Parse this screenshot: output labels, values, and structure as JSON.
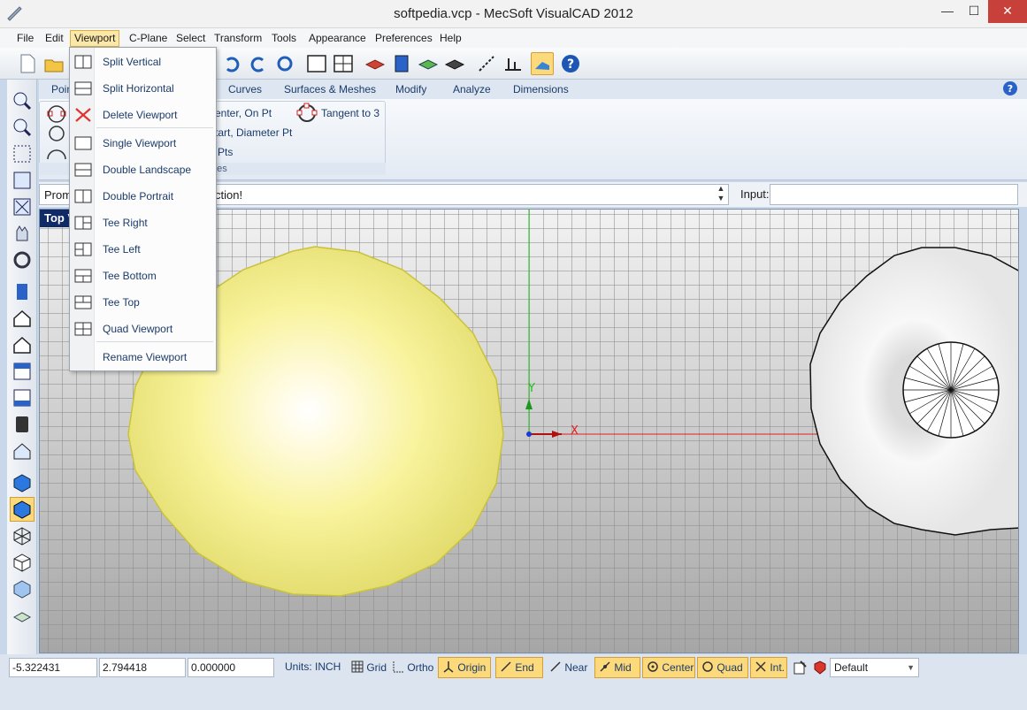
{
  "window": {
    "title": "softpedia.vcp - MecSoft VisualCAD 2012",
    "minimize": "—",
    "maximize": "☐",
    "close": "✕"
  },
  "menu": [
    "File",
    "Edit",
    "Viewport",
    "C-Plane",
    "Select",
    "Transform",
    "Tools",
    "Appearance",
    "Preferences",
    "Help"
  ],
  "ribbon": {
    "tabs": [
      "Poin",
      "Curves",
      "Surfaces & Meshes",
      "Modify",
      "Analyze",
      "Dimensions"
    ],
    "items": [
      "enter, On Pt",
      "tart, Diameter Pt",
      "Pts",
      "Tangent to 3"
    ],
    "group": "Circles"
  },
  "prompt": {
    "label": "Prom",
    "message": "ction!",
    "input_label": "Input:",
    "input_value": ""
  },
  "viewport": {
    "label": "Top V",
    "axis_x": "X",
    "axis_y": "Y"
  },
  "dropdown": {
    "items": [
      "Split Vertical",
      "Split Horizontal",
      "Delete Viewport",
      "Single Viewport",
      "Double Landscape",
      "Double Portrait",
      "Tee Right",
      "Tee Left",
      "Tee Bottom",
      "Tee Top",
      "Quad Viewport",
      "Rename Viewport"
    ]
  },
  "status": {
    "x": "-5.322431",
    "y": "2.794418",
    "z": "0.000000",
    "units": "Units: INCH",
    "buttons": [
      "Grid",
      "Ortho",
      "Origin",
      "End",
      "Near",
      "Mid",
      "Center",
      "Quad",
      "Int."
    ],
    "layer": "Default"
  },
  "colors": {
    "accent": "#fcd97a",
    "sphere": "#f5f29a",
    "x_axis": "#e02020",
    "y_axis": "#20c020"
  }
}
